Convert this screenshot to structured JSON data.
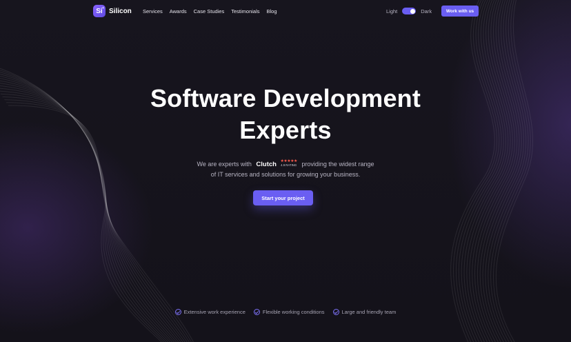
{
  "brand": {
    "mark": "Si",
    "name": "Silicon"
  },
  "nav": [
    "Services",
    "Awards",
    "Case Studies",
    "Testimonials",
    "Blog"
  ],
  "theme": {
    "light_label": "Light",
    "dark_label": "Dark",
    "dark_enabled": true
  },
  "header": {
    "cta_label": "Work with us"
  },
  "hero": {
    "title_line1": "Software Development",
    "title_line2": "Experts",
    "desc_before": "We are experts with",
    "clutch_name": "Clutch",
    "clutch_stars": "★★★★★",
    "clutch_rating": "4.9 RATING",
    "desc_after": "providing the widest range",
    "desc_line2": "of IT services and solutions for growing your business.",
    "cta_label": "Start your project"
  },
  "features": [
    "Extensive work experience",
    "Flexible working conditions",
    "Large and friendly team"
  ],
  "colors": {
    "accent": "#6a5ef2",
    "background": "#15131c",
    "star": "#ff5c4d"
  }
}
